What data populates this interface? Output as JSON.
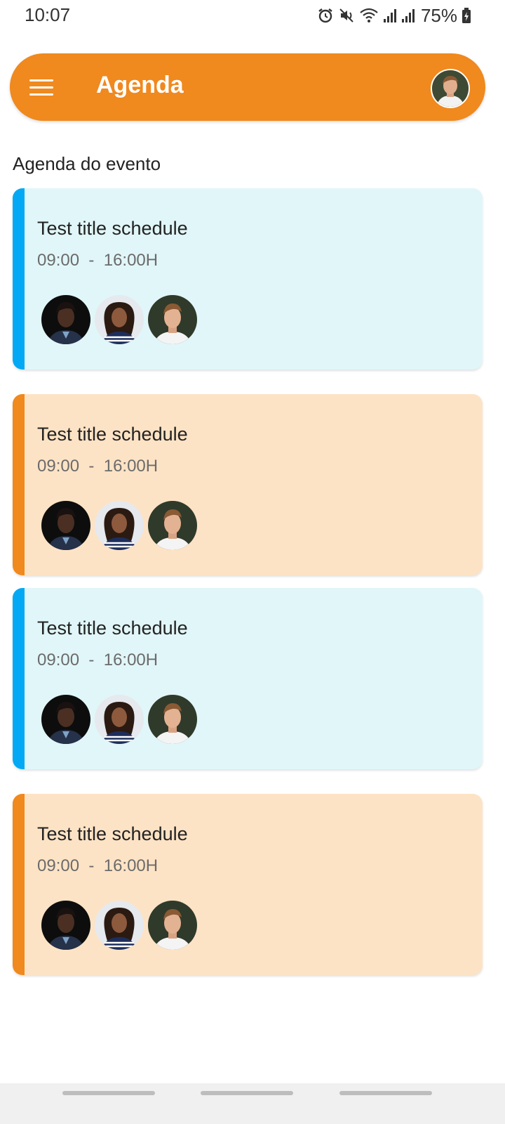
{
  "status_bar": {
    "time": "10:07",
    "battery": "75%",
    "icons": [
      "alarm-icon",
      "mute-icon",
      "wifi-icon",
      "signal-icon",
      "signal-icon",
      "battery-charging-icon"
    ]
  },
  "app_bar": {
    "title": "Agenda",
    "menu_icon": "hamburger-menu-icon",
    "avatar": "profile-avatar",
    "background": "#f0891e"
  },
  "section": {
    "title": "Agenda do evento"
  },
  "colors": {
    "blue_card_bg": "#e1f6f8",
    "blue_accent": "#03a9f4",
    "orange_card_bg": "#fde3c5",
    "orange_accent": "#f0891e"
  },
  "schedule": [
    {
      "title": "Test title schedule",
      "time": "09:00  -  16:00H",
      "variant": "blue"
    },
    {
      "title": "Test title schedule",
      "time": "09:00  -  16:00H",
      "variant": "orange"
    },
    {
      "title": "Test title schedule",
      "time": "09:00  -  16:00H",
      "variant": "blue"
    },
    {
      "title": "Test title schedule",
      "time": "09:00  -  16:00H",
      "variant": "orange"
    }
  ]
}
